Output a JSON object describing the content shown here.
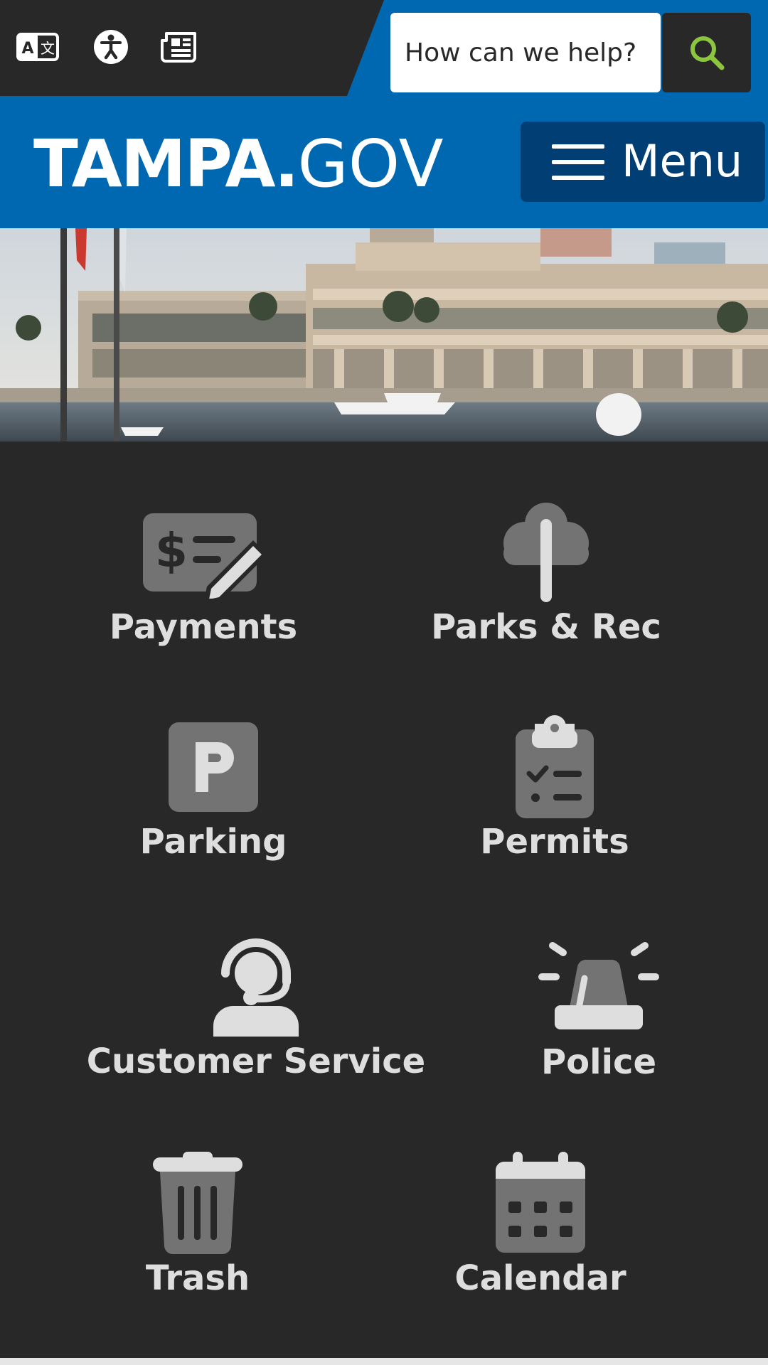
{
  "utility_bar": {
    "icons": [
      "translate-icon",
      "accessibility-icon",
      "newspaper-icon"
    ],
    "search": {
      "placeholder": "How can we help?"
    },
    "search_button_icon": "magnifier-icon"
  },
  "header": {
    "logo": {
      "main": "TAMPA",
      "dot": ".",
      "tld": "GOV"
    },
    "menu": {
      "label": "Menu",
      "icon": "hamburger-icon"
    }
  },
  "hero": {
    "subject": "harbor-photo"
  },
  "quick_links": [
    {
      "label": "Payments",
      "icon": "payments-icon"
    },
    {
      "label": "Parks & Rec",
      "icon": "tree-icon"
    },
    {
      "label": "Parking",
      "icon": "parking-icon"
    },
    {
      "label": "Permits",
      "icon": "clipboard-icon"
    },
    {
      "label": "Customer Service",
      "icon": "headset-icon"
    },
    {
      "label": "Police",
      "icon": "siren-icon"
    },
    {
      "label": "Trash",
      "icon": "trash-icon"
    },
    {
      "label": "Calendar",
      "icon": "calendar-icon"
    }
  ],
  "colors": {
    "brand_blue": "#0068b1",
    "menu_navy": "#003e73",
    "dark_bg": "#282828",
    "icon_gray": "#737373",
    "label_gray": "#dedede",
    "search_green": "#8cc63f"
  }
}
